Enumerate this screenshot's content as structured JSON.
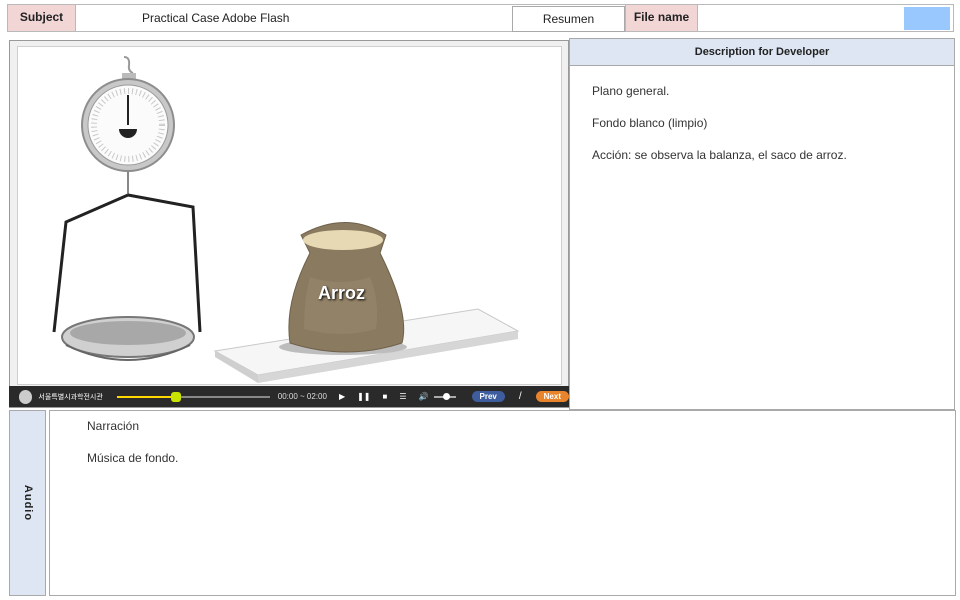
{
  "header": {
    "subject_label": "Subject",
    "subject_value": "Practical Case Adobe Flash",
    "resumen": "Resumen",
    "file_name_label": "File name",
    "file_name_value": "",
    "swatch_color": "#99c8ff"
  },
  "stage": {
    "bag_label": "Arroz",
    "bag_color": "#8a7a60",
    "rice_color": "#e7d9b4"
  },
  "player": {
    "brand": "서울특별시과학전시관",
    "time": "00:00 ~ 02:00",
    "prev": "Prev",
    "separator": "/",
    "next": "Next",
    "progress": 0.37
  },
  "description": {
    "title": "Description for Developer",
    "lines": [
      "Plano general.",
      "Fondo blanco (limpio)",
      "Acción: se observa la balanza, el saco de arroz."
    ]
  },
  "audio": {
    "label": "Audio",
    "lines": [
      "Narración",
      "Música de fondo."
    ]
  }
}
